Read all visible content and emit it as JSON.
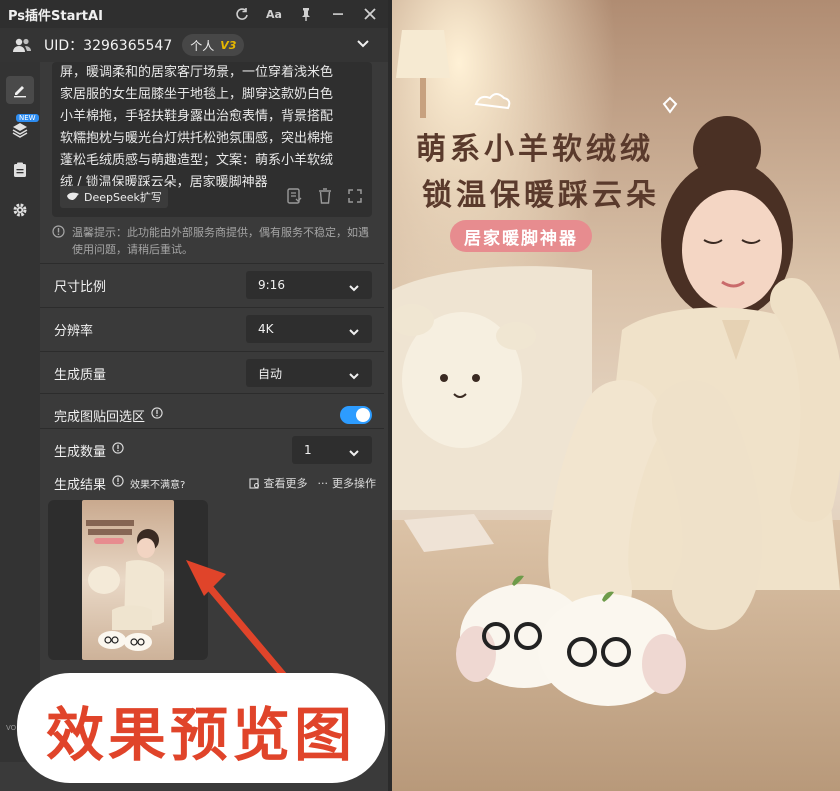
{
  "window": {
    "title": "Ps插件StartAI"
  },
  "user": {
    "uid_text": "UID：3296365547",
    "plan": "个人",
    "level": "V3"
  },
  "rail": {
    "new_tag": "NEW",
    "version_fragment": "VO"
  },
  "prompt": {
    "text": "屏，暖调柔和的居家客厅场景，一位穿着浅米色\n家居服的女生屈膝坐于地毯上，脚穿这款奶白色\n小羊棉拖，手轻扶鞋身露出治愈表情，背景搭配\n软糯抱枕与暖光台灯烘托松弛氛围感，突出棉拖\n蓬松毛绒质感与萌趣造型；文案：萌系小羊软绒\n绒 / 锁温保暖踩云朵，居家暖脚神器",
    "deepseek_label": "DeepSeek扩写",
    "tip": "温馨提示：此功能由外部服务商提供，偶有服务不稳定，如遇使用问题，请稍后重试。"
  },
  "settings": {
    "aspect_label": "尺寸比例",
    "aspect_value": "9:16",
    "resolution_label": "分辨率",
    "resolution_value": "4K",
    "quality_label": "生成质量",
    "quality_value": "自动",
    "paste_back_label": "完成图贴回选区",
    "paste_back_on": true,
    "count_label": "生成数量",
    "count_value": "1"
  },
  "results": {
    "label": "生成结果",
    "unsatisfied": "效果不满意?",
    "view_more": "查看更多",
    "more_actions": "更多操作"
  },
  "annotation": {
    "text": "效果预览图",
    "color": "#e0442a"
  },
  "product_image": {
    "line1": "萌系小羊软绒绒",
    "line2": "锁温保暖踩云朵",
    "tag": "居家暖脚神器"
  },
  "colors": {
    "toggle_on": "#2d9cff",
    "panel_bg": "#3a3a3a",
    "tag_pink": "#e78c8f"
  }
}
